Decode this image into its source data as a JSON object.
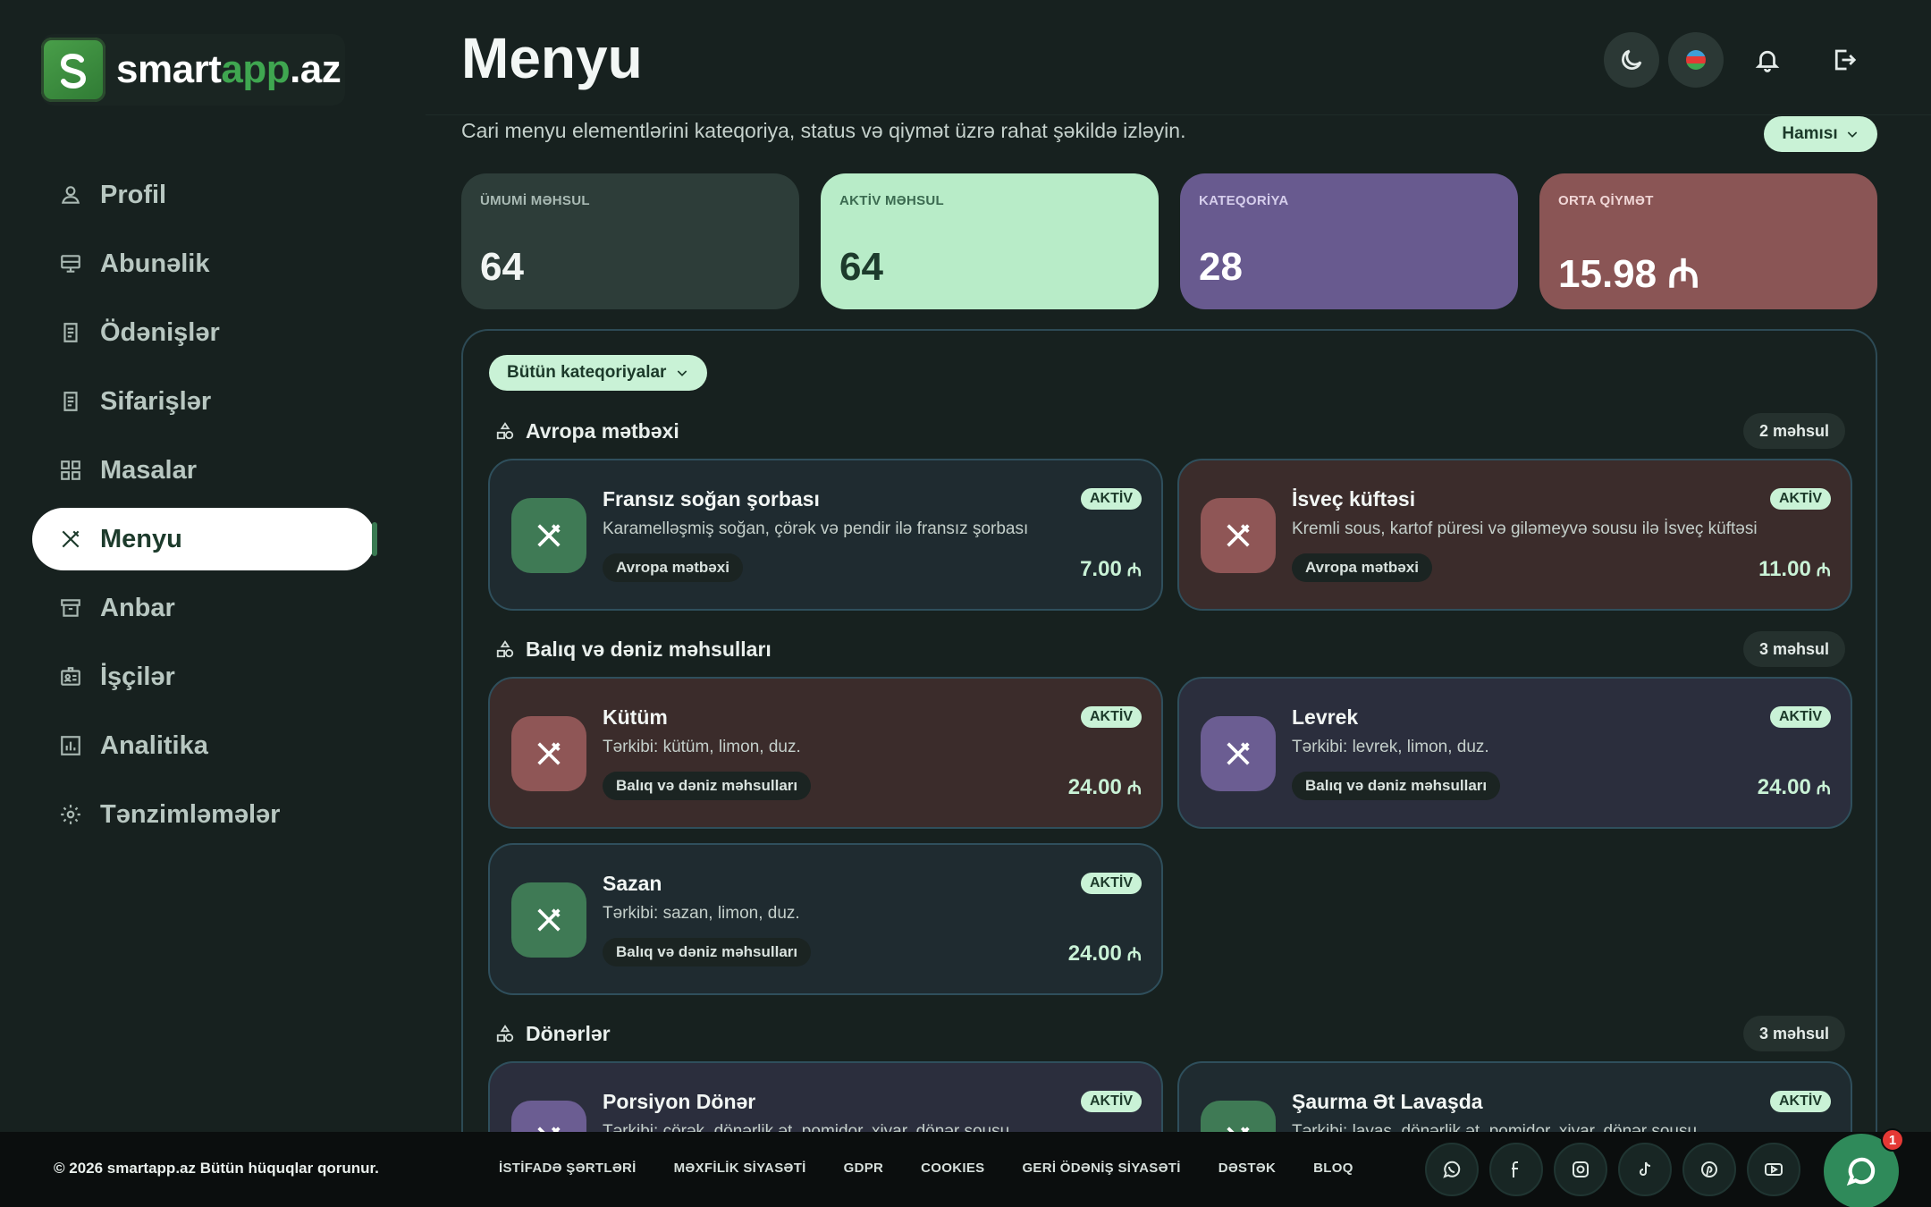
{
  "brand": {
    "name_main": "smart",
    "name_accent": "app",
    "name_tld": ".az",
    "accent_color": "#3fa650"
  },
  "sidebar": {
    "items": [
      {
        "label": "Profil",
        "icon": "user-icon"
      },
      {
        "label": "Abunəlik",
        "icon": "subscription-icon"
      },
      {
        "label": "Ödənişlər",
        "icon": "receipt-icon"
      },
      {
        "label": "Sifarişlər",
        "icon": "orders-icon"
      },
      {
        "label": "Masalar",
        "icon": "grid-icon"
      },
      {
        "label": "Menyu",
        "icon": "utensils-icon",
        "active": true
      },
      {
        "label": "Anbar",
        "icon": "archive-icon"
      },
      {
        "label": "İşçilər",
        "icon": "id-card-icon"
      },
      {
        "label": "Analitika",
        "icon": "chart-icon"
      },
      {
        "label": "Tənzimləmələr",
        "icon": "gear-icon"
      }
    ]
  },
  "header": {
    "title": "Menyu",
    "subtitle": "Cari menyu elementlərini kateqoriya, status və qiymət üzrə rahat şəkildə izləyin.",
    "status_filter": "Hamısı"
  },
  "stats": [
    {
      "label": "ÜMUMİ MƏHSUL",
      "value": "64"
    },
    {
      "label": "AKTİV MƏHSUL",
      "value": "64"
    },
    {
      "label": "KATEQORİYA",
      "value": "28"
    },
    {
      "label": "ORTA QİYMƏT",
      "value": "15.98 ₼"
    }
  ],
  "category_filter": "Bütün kateqoriyalar",
  "sections": [
    {
      "title": "Avropa mətbəxi",
      "count": "2 məhsul",
      "items": [
        {
          "name": "Fransız soğan şorbası",
          "desc": "Karamelləşmiş soğan, çörək və pendir ilə fransız şorbası",
          "tag": "Avropa mətbəxi",
          "status": "AKTİV",
          "price": "7.00",
          "currency": "₼"
        },
        {
          "name": "İsveç küftəsi",
          "desc": "Kremli sous, kartof püresi və giləmeyvə sousu ilə İsveç küftəsi",
          "tag": "Avropa mətbəxi",
          "status": "AKTİV",
          "price": "11.00",
          "currency": "₼"
        }
      ]
    },
    {
      "title": "Balıq və dəniz məhsulları",
      "count": "3 məhsul",
      "items": [
        {
          "name": "Kütüm",
          "desc": "Tərkibi: kütüm, limon, duz.",
          "tag": "Balıq və dəniz məhsulları",
          "status": "AKTİV",
          "price": "24.00",
          "currency": "₼"
        },
        {
          "name": "Levrek",
          "desc": "Tərkibi: levrek, limon, duz.",
          "tag": "Balıq və dəniz məhsulları",
          "status": "AKTİV",
          "price": "24.00",
          "currency": "₼"
        },
        {
          "name": "Sazan",
          "desc": "Tərkibi: sazan, limon, duz.",
          "tag": "Balıq və dəniz məhsulları",
          "status": "AKTİV",
          "price": "24.00",
          "currency": "₼"
        }
      ]
    },
    {
      "title": "Dönərlər",
      "count": "3 məhsul",
      "items": [
        {
          "name": "Porsiyon Dönər",
          "desc": "Tərkibi: çörək, dönərlik ət, pomidor, xiyar, dönər sousu",
          "status": "AKTİV"
        },
        {
          "name": "Şaurma Ət Lavaşda",
          "desc": "Tərkibi: lavaş, dönərlik ət, pomidor, xiyar, dönər sousu",
          "status": "AKTİV"
        }
      ]
    }
  ],
  "footer": {
    "copyright": "© 2026 smartapp.az Bütün hüquqlar qorunur.",
    "links": [
      "İSTİFADƏ ŞƏRTLƏRİ",
      "MƏXFİLİK SİYASƏTİ",
      "GDPR",
      "COOKIES",
      "GERİ ÖDƏNİŞ SİYASƏTİ",
      "DƏSTƏK",
      "BLOQ"
    ],
    "socials": [
      "whatsapp-icon",
      "facebook-icon",
      "instagram-icon",
      "tiktok-icon",
      "pinterest-icon",
      "youtube-icon"
    ],
    "chat_badge": "1"
  }
}
